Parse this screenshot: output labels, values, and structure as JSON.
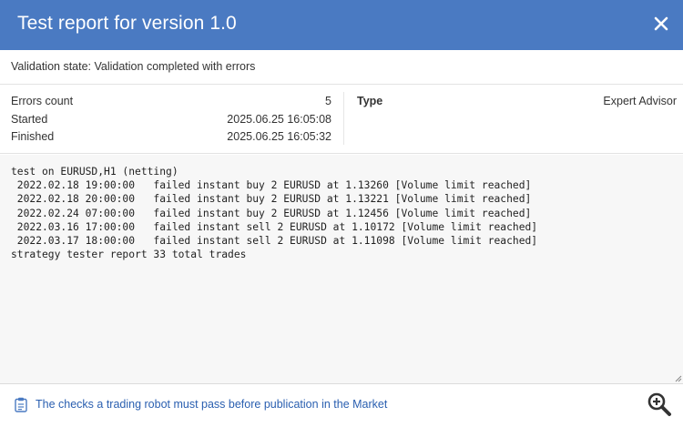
{
  "window": {
    "title": "Test report for version 1.0"
  },
  "validation": {
    "text": "Validation state: Validation completed with errors"
  },
  "meta": {
    "rows": [
      {
        "label": "Errors count",
        "value": "5"
      },
      {
        "label": "Started",
        "value": "2025.06.25 16:05:08"
      },
      {
        "label": "Finished",
        "value": "2025.06.25 16:05:32"
      }
    ],
    "type_label": "Type",
    "type_value": "Expert Advisor"
  },
  "log": {
    "lines": [
      "test on EURUSD,H1 (netting)",
      " 2022.02.18 19:00:00   failed instant buy 2 EURUSD at 1.13260 [Volume limit reached]",
      " 2022.02.18 20:00:00   failed instant buy 2 EURUSD at 1.13221 [Volume limit reached]",
      " 2022.02.24 07:00:00   failed instant buy 2 EURUSD at 1.12456 [Volume limit reached]",
      " 2022.03.16 17:00:00   failed instant sell 2 EURUSD at 1.10172 [Volume limit reached]",
      " 2022.03.17 18:00:00   failed instant sell 2 EURUSD at 1.11098 [Volume limit reached]",
      "strategy tester report 33 total trades"
    ]
  },
  "footer": {
    "link_text": "The checks a trading robot must pass before publication in the Market"
  },
  "icons": {
    "close": "close-icon",
    "clipboard": "clipboard-icon",
    "zoom": "zoom-in-icon"
  },
  "colors": {
    "header_bg": "#4a7ac2",
    "link": "#2a5fb0",
    "log_bg": "#f7f7f7"
  }
}
